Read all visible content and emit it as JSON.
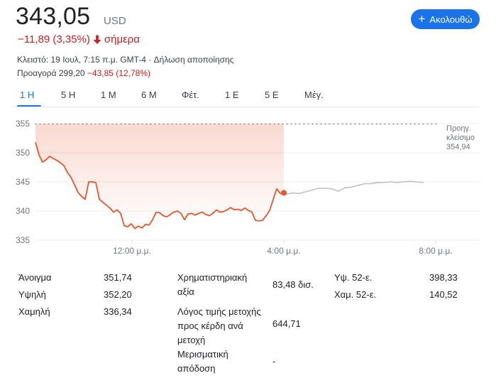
{
  "quote": {
    "price": "343,05",
    "currency": "USD",
    "change": "−11,89 (3,35%)",
    "change_period": "σήμερα",
    "closed_info": "Κλειστό: 19 Ιουλ, 7:15 π.μ. GMT-4 · ",
    "disclaimer": "Δήλωση αποποίησης",
    "premarket_label": "Προαγορά 299,20 ",
    "premarket_change": "−43,85 (12,78%)"
  },
  "follow_button": {
    "label": "Ακολουθώ"
  },
  "tabs": [
    "1 Η",
    "5 Η",
    "1 Μ",
    "6 Μ",
    "Φέτ.",
    "1 Ε",
    "5 Ε",
    "Μέγ."
  ],
  "active_tab": 0,
  "chart_data": {
    "type": "line",
    "y_ticks": [
      "355",
      "350",
      "345",
      "340",
      "335"
    ],
    "x_ticks": [
      "12:00 μ.μ.",
      "4:00 μ.μ.",
      "8:00 μ.μ."
    ],
    "ylim": [
      335,
      355
    ],
    "prev_close_label_1": "Προηγ.",
    "prev_close_label_2": "κλείσιμο",
    "prev_close_value": "354,94",
    "prev_close": 354.94,
    "series": [
      {
        "color": "#e8542b",
        "values": [
          351.8,
          349.6,
          348.4,
          348.8,
          349.4,
          349.0,
          348.7,
          348.3,
          347.8,
          346.6,
          345.8,
          344.5,
          343.2,
          342.5,
          342.0,
          345.0,
          345.0,
          344.9,
          342.0,
          341.5,
          341.0,
          340.5,
          339.8,
          340.2,
          339.6,
          337.5,
          337.3,
          337.8,
          337.0,
          337.4,
          337.1,
          337.7,
          337.6,
          338.5,
          339.8,
          339.7,
          339.2,
          339.0,
          339.4,
          339.8,
          340.0,
          339.6,
          338.5,
          339.5,
          339.6,
          339.3,
          339.6,
          339.8,
          339.4,
          339.2,
          339.6,
          340.2,
          339.8,
          339.9,
          340.2,
          340.6,
          340.2,
          340.3,
          340.1,
          340.5,
          340.1,
          339.8,
          338.4,
          338.3,
          338.4,
          339.2,
          340.1,
          342.0,
          343.8,
          343.0,
          343.0
        ]
      },
      {
        "color": "#bdc1c6",
        "values": [
          342.9,
          343.1,
          343.0,
          343.3,
          343.6,
          343.9,
          343.9,
          343.8,
          343.4,
          344.0,
          344.1,
          344.4,
          344.7,
          344.7,
          344.9,
          344.9,
          345.0,
          344.9,
          345.0,
          345.1,
          345.0,
          344.9
        ]
      }
    ],
    "last_point": 343.0
  },
  "stats": {
    "col1": [
      {
        "label": "Άνοιγμα",
        "value": "351,74"
      },
      {
        "label": "Υψηλή",
        "value": "352,20"
      },
      {
        "label": "Χαμηλή",
        "value": "336,34"
      }
    ],
    "col2": [
      {
        "label_lines": [
          "Χρηματιστηριακή",
          "αξία"
        ],
        "value": "83,48 δισ."
      },
      {
        "label_lines": [
          "Λόγος τιμής μετοχής",
          "προς κέρδη ανά",
          "μετοχή"
        ],
        "value": "644,71"
      },
      {
        "label_lines": [
          "Μερισματική",
          "απόδοση"
        ],
        "value": "-"
      }
    ],
    "col3": [
      {
        "label": "Υψ. 52-ε.",
        "value": "398,33"
      },
      {
        "label": "Χαμ. 52-ε.",
        "value": "140,52"
      }
    ]
  }
}
